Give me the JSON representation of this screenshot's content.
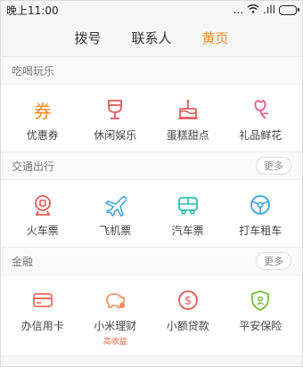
{
  "status_bar": {
    "time": "晚上11:00",
    "dots": "...",
    "signal": ".ıll"
  },
  "tabs": [
    {
      "label": "拨号"
    },
    {
      "label": "联系人"
    },
    {
      "label": "黄页"
    }
  ],
  "sections": [
    {
      "title": "吃喝玩乐",
      "items": [
        {
          "label": "优惠券",
          "icon": "coupon-icon",
          "glyph": "券",
          "color": "#f28a1f"
        },
        {
          "label": "休闲娱乐",
          "icon": "wine-glass-icon",
          "color": "#e45a5a"
        },
        {
          "label": "蛋糕甜点",
          "icon": "cake-icon",
          "color": "#e45a5a"
        },
        {
          "label": "礼品鲜花",
          "icon": "flower-icon",
          "color": "#e45a8c"
        }
      ]
    },
    {
      "title": "交通出行",
      "more": "更多",
      "items": [
        {
          "label": "火车票",
          "icon": "train-icon",
          "color": "#e45a5a"
        },
        {
          "label": "飞机票",
          "icon": "airplane-icon",
          "color": "#3aa6e0"
        },
        {
          "label": "汽车票",
          "icon": "bus-icon",
          "color": "#29bfae"
        },
        {
          "label": "打车租车",
          "icon": "steering-wheel-icon",
          "color": "#3aa6e0"
        }
      ]
    },
    {
      "title": "金融",
      "more": "更多",
      "items": [
        {
          "label": "办信用卡",
          "icon": "credit-card-icon",
          "color": "#f06a5a"
        },
        {
          "label": "小米理财",
          "icon": "piggy-bank-icon",
          "color": "#f08a5a",
          "badge": "高收益"
        },
        {
          "label": "小额贷款",
          "icon": "dollar-coin-icon",
          "color": "#e45a5a"
        },
        {
          "label": "平安保险",
          "icon": "shield-icon",
          "color": "#7bbf3a"
        }
      ]
    }
  ]
}
